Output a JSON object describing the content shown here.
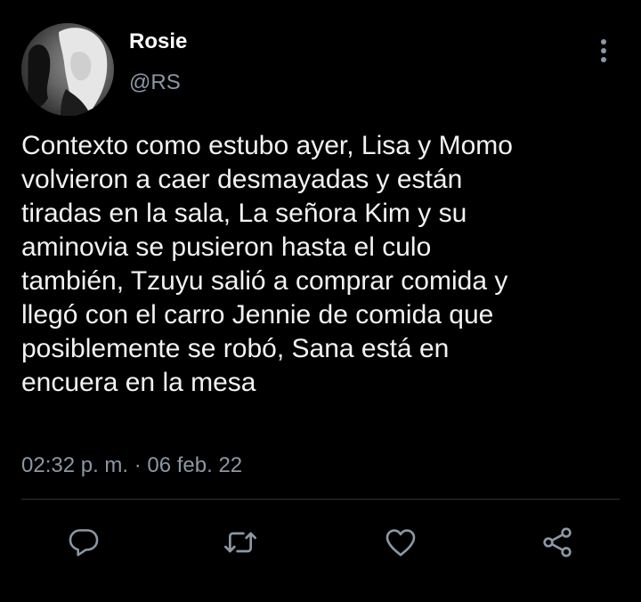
{
  "tweet": {
    "author": {
      "display_name": "Rosie",
      "handle": "@RS"
    },
    "text_lines": [
      "Contexto como estubo ayer, Lisa y Momo",
      "volvieron a caer desmayadas y están",
      "tiradas en la sala, La señora Kim y su",
      "aminovia se pusieron hasta el culo",
      "también, Tzuyu salió a comprar comida y",
      "llegó con el carro Jennie de comida que",
      "posiblemente se robó, Sana está en",
      "encuera en la mesa"
    ],
    "timestamp": "02:32 p. m. · 06 feb. 22"
  },
  "actions": {
    "reply_icon": "reply-icon",
    "retweet_icon": "retweet-icon",
    "like_icon": "heart-icon",
    "share_icon": "share-icon",
    "more_icon": "more-vertical-icon"
  },
  "colors": {
    "background": "#000000",
    "text": "#f2f2f2",
    "secondary": "#8b98a5",
    "divider": "#2f3336"
  }
}
